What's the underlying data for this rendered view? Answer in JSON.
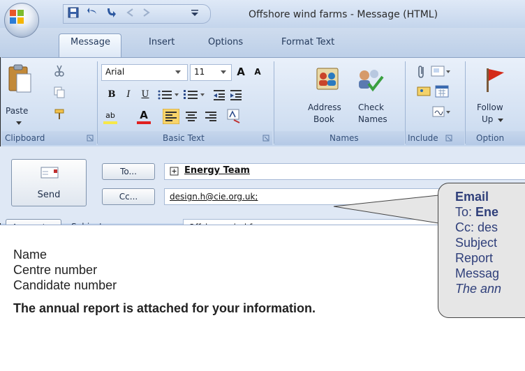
{
  "window": {
    "title": "Offshore wind farms - Message (HTML)"
  },
  "tabs": [
    {
      "label": "Message"
    },
    {
      "label": "Insert"
    },
    {
      "label": "Options"
    },
    {
      "label": "Format Text"
    }
  ],
  "ribbon": {
    "clipboard": {
      "paste_label": "Paste",
      "group_label": "Clipboard"
    },
    "basic_text": {
      "font_name": "Arial",
      "font_size": "11",
      "grow_font": "A",
      "shrink_font": "A",
      "bold": "B",
      "italic": "I",
      "underline": "U",
      "highlight": "ab",
      "font_color": "A",
      "group_label": "Basic Text"
    },
    "names": {
      "address_book_line1": "Address",
      "address_book_line2": "Book",
      "check_names_line1": "Check",
      "check_names_line2": "Names",
      "group_label": "Names"
    },
    "include": {
      "group_label": "Include"
    },
    "options": {
      "follow_up_line1": "Follow",
      "follow_up_line2": "Up",
      "group_label": "Option"
    }
  },
  "compose": {
    "send_label": "Send",
    "to_button": "To...",
    "cc_button": "Cc...",
    "account_button": "Account",
    "subject_label": "Subject:",
    "to_value": "Energy Team",
    "cc_value": "design.h@cie.org.uk;",
    "subject_value": "Offshore wind farms"
  },
  "body": {
    "lines": [
      "Name",
      "Centre number",
      "Candidate number"
    ],
    "message": "The annual report is attached for your information."
  },
  "callout": {
    "heading": "Email",
    "to_prefix": "To: ",
    "to_value": "Ene",
    "cc_line": "Cc: des",
    "subject_line": "Subject",
    "report_line": "Report",
    "message_line": "Messag",
    "italic_line": "The ann"
  },
  "colors": {
    "ribbon_bg": "#d2e0f2",
    "tab_text": "#243a5c",
    "callout_text": "#2f3f7a",
    "callout_bg": "#e6e6e6"
  }
}
